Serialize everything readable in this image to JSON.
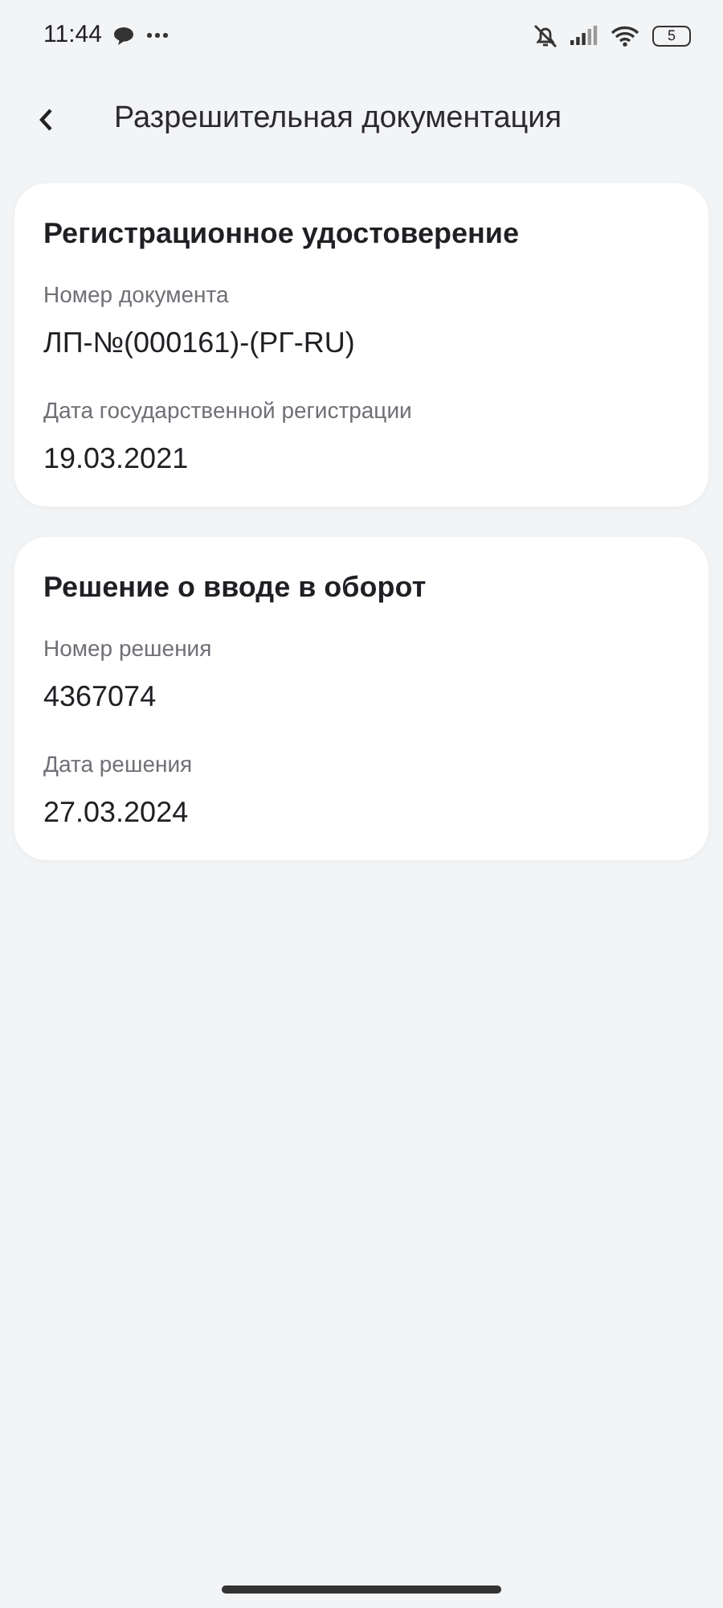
{
  "status_bar": {
    "time": "11:44",
    "battery": "5"
  },
  "header": {
    "title": "Разрешительная документация"
  },
  "cards": [
    {
      "title": "Регистрационное удостоверение",
      "fields": [
        {
          "label": "Номер документа",
          "value": "ЛП-№(000161)-(РГ-RU)"
        },
        {
          "label": "Дата государственной регистрации",
          "value": "19.03.2021"
        }
      ]
    },
    {
      "title": "Решение о вводе в оборот",
      "fields": [
        {
          "label": "Номер решения",
          "value": "4367074"
        },
        {
          "label": "Дата решения",
          "value": "27.03.2024"
        }
      ]
    }
  ]
}
